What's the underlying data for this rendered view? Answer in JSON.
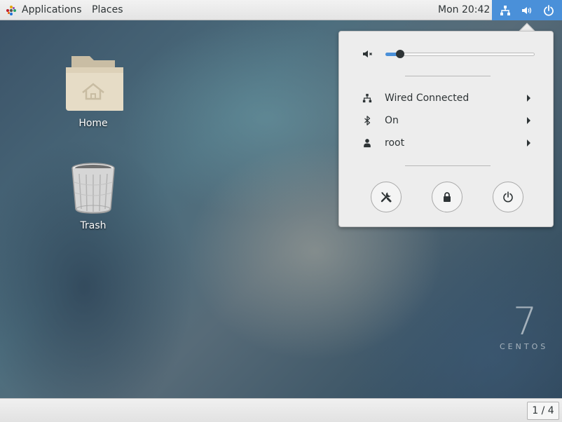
{
  "topbar": {
    "applications_label": "Applications",
    "places_label": "Places",
    "clock": "Mon 20:42"
  },
  "desktop": {
    "icons": [
      {
        "label": "Home"
      },
      {
        "label": "Trash"
      }
    ],
    "watermark": {
      "number": "7",
      "name": "CENTOS"
    }
  },
  "system_menu": {
    "volume_level": 0.1,
    "items": [
      {
        "label": "Wired Connected",
        "icon": "network-wired-icon"
      },
      {
        "label": "On",
        "icon": "bluetooth-icon"
      },
      {
        "label": "root",
        "icon": "user-icon"
      }
    ],
    "buttons": [
      {
        "name": "settings",
        "icon": "tools-icon"
      },
      {
        "name": "lock",
        "icon": "lock-icon"
      },
      {
        "name": "power-off",
        "icon": "power-icon"
      }
    ]
  },
  "bottombar": {
    "workspace_indicator": "1 / 4"
  },
  "colors": {
    "accent": "#4a90d9",
    "panel": "#ededed",
    "text": "#2e3436"
  }
}
